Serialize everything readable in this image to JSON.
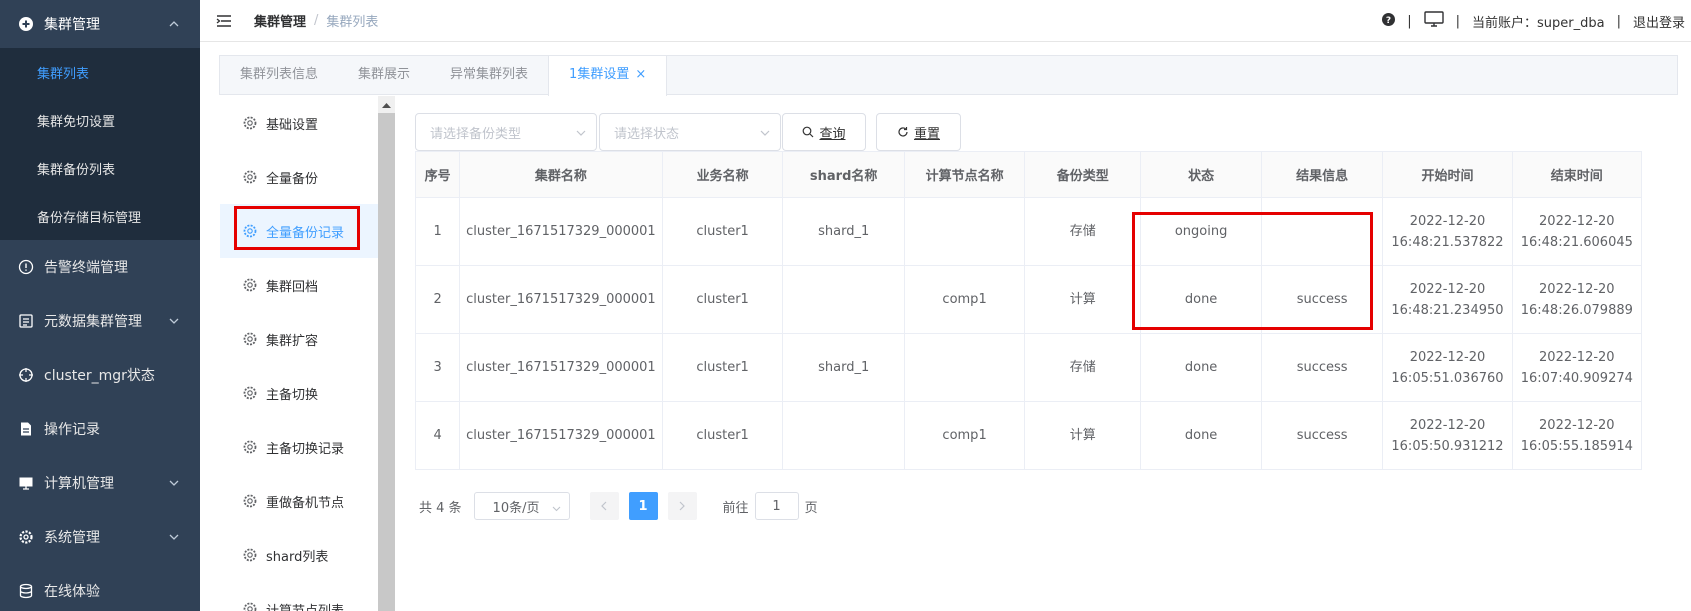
{
  "sidebar": {
    "group": {
      "label": "集群管理",
      "icon": "plus-circle-icon"
    },
    "sub_items": [
      {
        "label": "集群列表",
        "active": true
      },
      {
        "label": "集群免切设置"
      },
      {
        "label": "集群备份列表"
      },
      {
        "label": "备份存储目标管理"
      }
    ],
    "items": [
      {
        "label": "告警终端管理",
        "icon": "info-circle-icon"
      },
      {
        "label": "元数据集群管理",
        "icon": "document-icon",
        "expandable": true
      },
      {
        "label": "cluster_mgr状态",
        "icon": "crosshair-icon"
      },
      {
        "label": "操作记录",
        "icon": "file-icon"
      },
      {
        "label": "计算机管理",
        "icon": "monitor-icon",
        "expandable": true
      },
      {
        "label": "系统管理",
        "icon": "gear-icon",
        "expandable": true
      },
      {
        "label": "在线体验",
        "icon": "database-icon"
      }
    ],
    "bg_color": "#304156",
    "sub_bg_color": "#1f2d3d",
    "active_color": "#409eff"
  },
  "header": {
    "breadcrumb": [
      "集群管理",
      "集群列表"
    ],
    "account_label": "当前账户：super_dba",
    "logout_label": "退出登录"
  },
  "tabs": [
    {
      "label": "集群列表信息"
    },
    {
      "label": "集群展示"
    },
    {
      "label": "异常集群列表"
    },
    {
      "label": "1集群设置",
      "active": true,
      "closable": true
    }
  ],
  "settings_menu": [
    {
      "label": "基础设置"
    },
    {
      "label": "全量备份"
    },
    {
      "label": "全量备份记录",
      "active": true
    },
    {
      "label": "集群回档"
    },
    {
      "label": "集群扩容"
    },
    {
      "label": "主备切换"
    },
    {
      "label": "主备切换记录"
    },
    {
      "label": "重做备机节点"
    },
    {
      "label": "shard列表"
    },
    {
      "label": "计算节点列表"
    }
  ],
  "filters": {
    "backup_type_placeholder": "请选择备份类型",
    "status_placeholder": "请选择状态",
    "query_label": "查询",
    "reset_label": "重置"
  },
  "table": {
    "columns": [
      "序号",
      "集群名称",
      "业务名称",
      "shard名称",
      "计算节点名称",
      "备份类型",
      "状态",
      "结果信息",
      "开始时间",
      "结束时间"
    ],
    "rows": [
      [
        "1",
        "cluster_1671517329_000001",
        "cluster1",
        "shard_1",
        "",
        "存储",
        "ongoing",
        "",
        "2022-12-20 16:48:21.537822",
        "2022-12-20 16:48:21.606045"
      ],
      [
        "2",
        "cluster_1671517329_000001",
        "cluster1",
        "",
        "comp1",
        "计算",
        "done",
        "success",
        "2022-12-20 16:48:21.234950",
        "2022-12-20 16:48:26.079889"
      ],
      [
        "3",
        "cluster_1671517329_000001",
        "cluster1",
        "shard_1",
        "",
        "存储",
        "done",
        "success",
        "2022-12-20 16:05:51.036760",
        "2022-12-20 16:07:40.909274"
      ],
      [
        "4",
        "cluster_1671517329_000001",
        "cluster1",
        "",
        "comp1",
        "计算",
        "done",
        "success",
        "2022-12-20 16:05:50.931212",
        "2022-12-20 16:05:55.185914"
      ]
    ]
  },
  "pagination": {
    "total_label": "共 4 条",
    "page_size_label": "10条/页",
    "current_page": "1",
    "goto_prefix": "前往",
    "goto_value": "1",
    "goto_suffix": "页"
  },
  "highlight_color": "#e50000"
}
